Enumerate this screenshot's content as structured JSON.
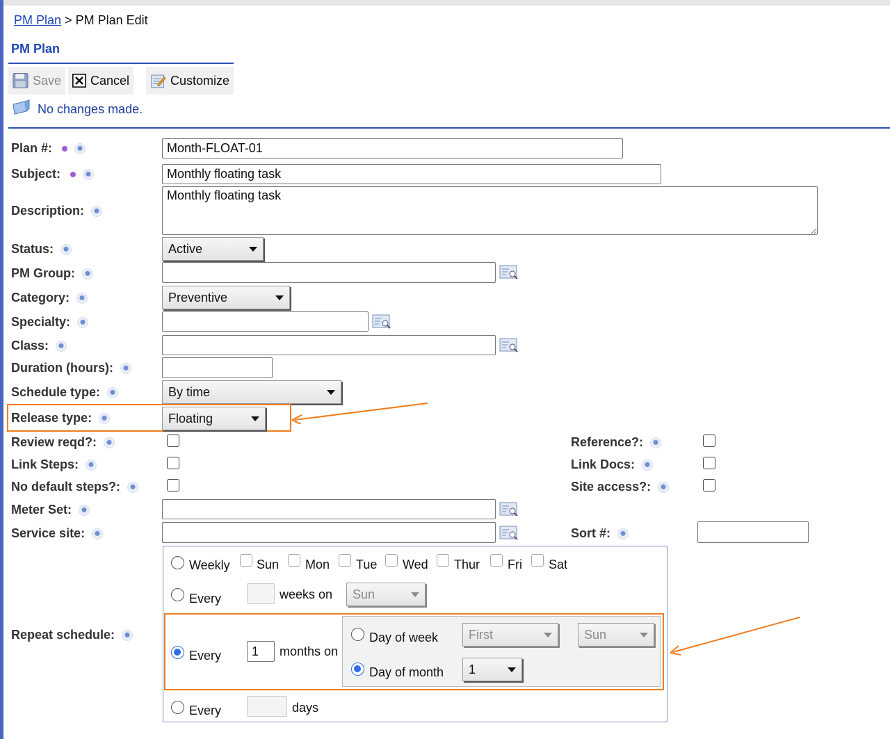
{
  "breadcrumb": {
    "link": "PM Plan",
    "separator": ">",
    "current": "PM Plan Edit"
  },
  "page_title": "PM Plan",
  "toolbar": {
    "save": "Save",
    "cancel": "Cancel",
    "customize": "Customize"
  },
  "status_message": "No changes made.",
  "fields": {
    "plan_no": {
      "label": "Plan #:",
      "value": "Month-FLOAT-01"
    },
    "subject": {
      "label": "Subject:",
      "value": "Monthly floating task"
    },
    "description": {
      "label": "Description:",
      "value": "Monthly floating task"
    },
    "status": {
      "label": "Status:",
      "value": "Active"
    },
    "pm_group": {
      "label": "PM Group:",
      "value": ""
    },
    "category": {
      "label": "Category:",
      "value": "Preventive"
    },
    "specialty": {
      "label": "Specialty:",
      "value": ""
    },
    "class": {
      "label": "Class:",
      "value": ""
    },
    "duration": {
      "label": "Duration (hours):",
      "value": ""
    },
    "schedule_type": {
      "label": "Schedule type:",
      "value": "By time"
    },
    "release_type": {
      "label": "Release type:",
      "value": "Floating"
    },
    "review_reqd": {
      "label": "Review reqd?:",
      "checked": false
    },
    "link_steps": {
      "label": "Link Steps:",
      "checked": false
    },
    "no_default_steps": {
      "label": "No default steps?:",
      "checked": false
    },
    "reference": {
      "label": "Reference?:",
      "checked": false
    },
    "link_docs": {
      "label": "Link Docs:",
      "checked": false
    },
    "site_access": {
      "label": "Site access?:",
      "checked": false
    },
    "meter_set": {
      "label": "Meter Set:",
      "value": ""
    },
    "service_site": {
      "label": "Service site:",
      "value": ""
    },
    "sort_no": {
      "label": "Sort #:",
      "value": ""
    }
  },
  "repeat": {
    "label": "Repeat schedule:",
    "weekly": "Weekly",
    "days": [
      "Sun",
      "Mon",
      "Tue",
      "Wed",
      "Thur",
      "Fri",
      "Sat"
    ],
    "every": "Every",
    "weeks_on": "weeks on",
    "weeks_day": "Sun",
    "months_value": "1",
    "months_on": "months on",
    "day_of_week": "Day of week",
    "day_of_week_ordinal": "First",
    "day_of_week_day": "Sun",
    "day_of_month": "Day of month",
    "day_of_month_value": "1",
    "days_label": "days",
    "selected": "monthly-day-of-month"
  },
  "colors": {
    "accent": "#1e47b5",
    "highlight": "#f07d1e",
    "radio_selected": "#2f6de6"
  }
}
